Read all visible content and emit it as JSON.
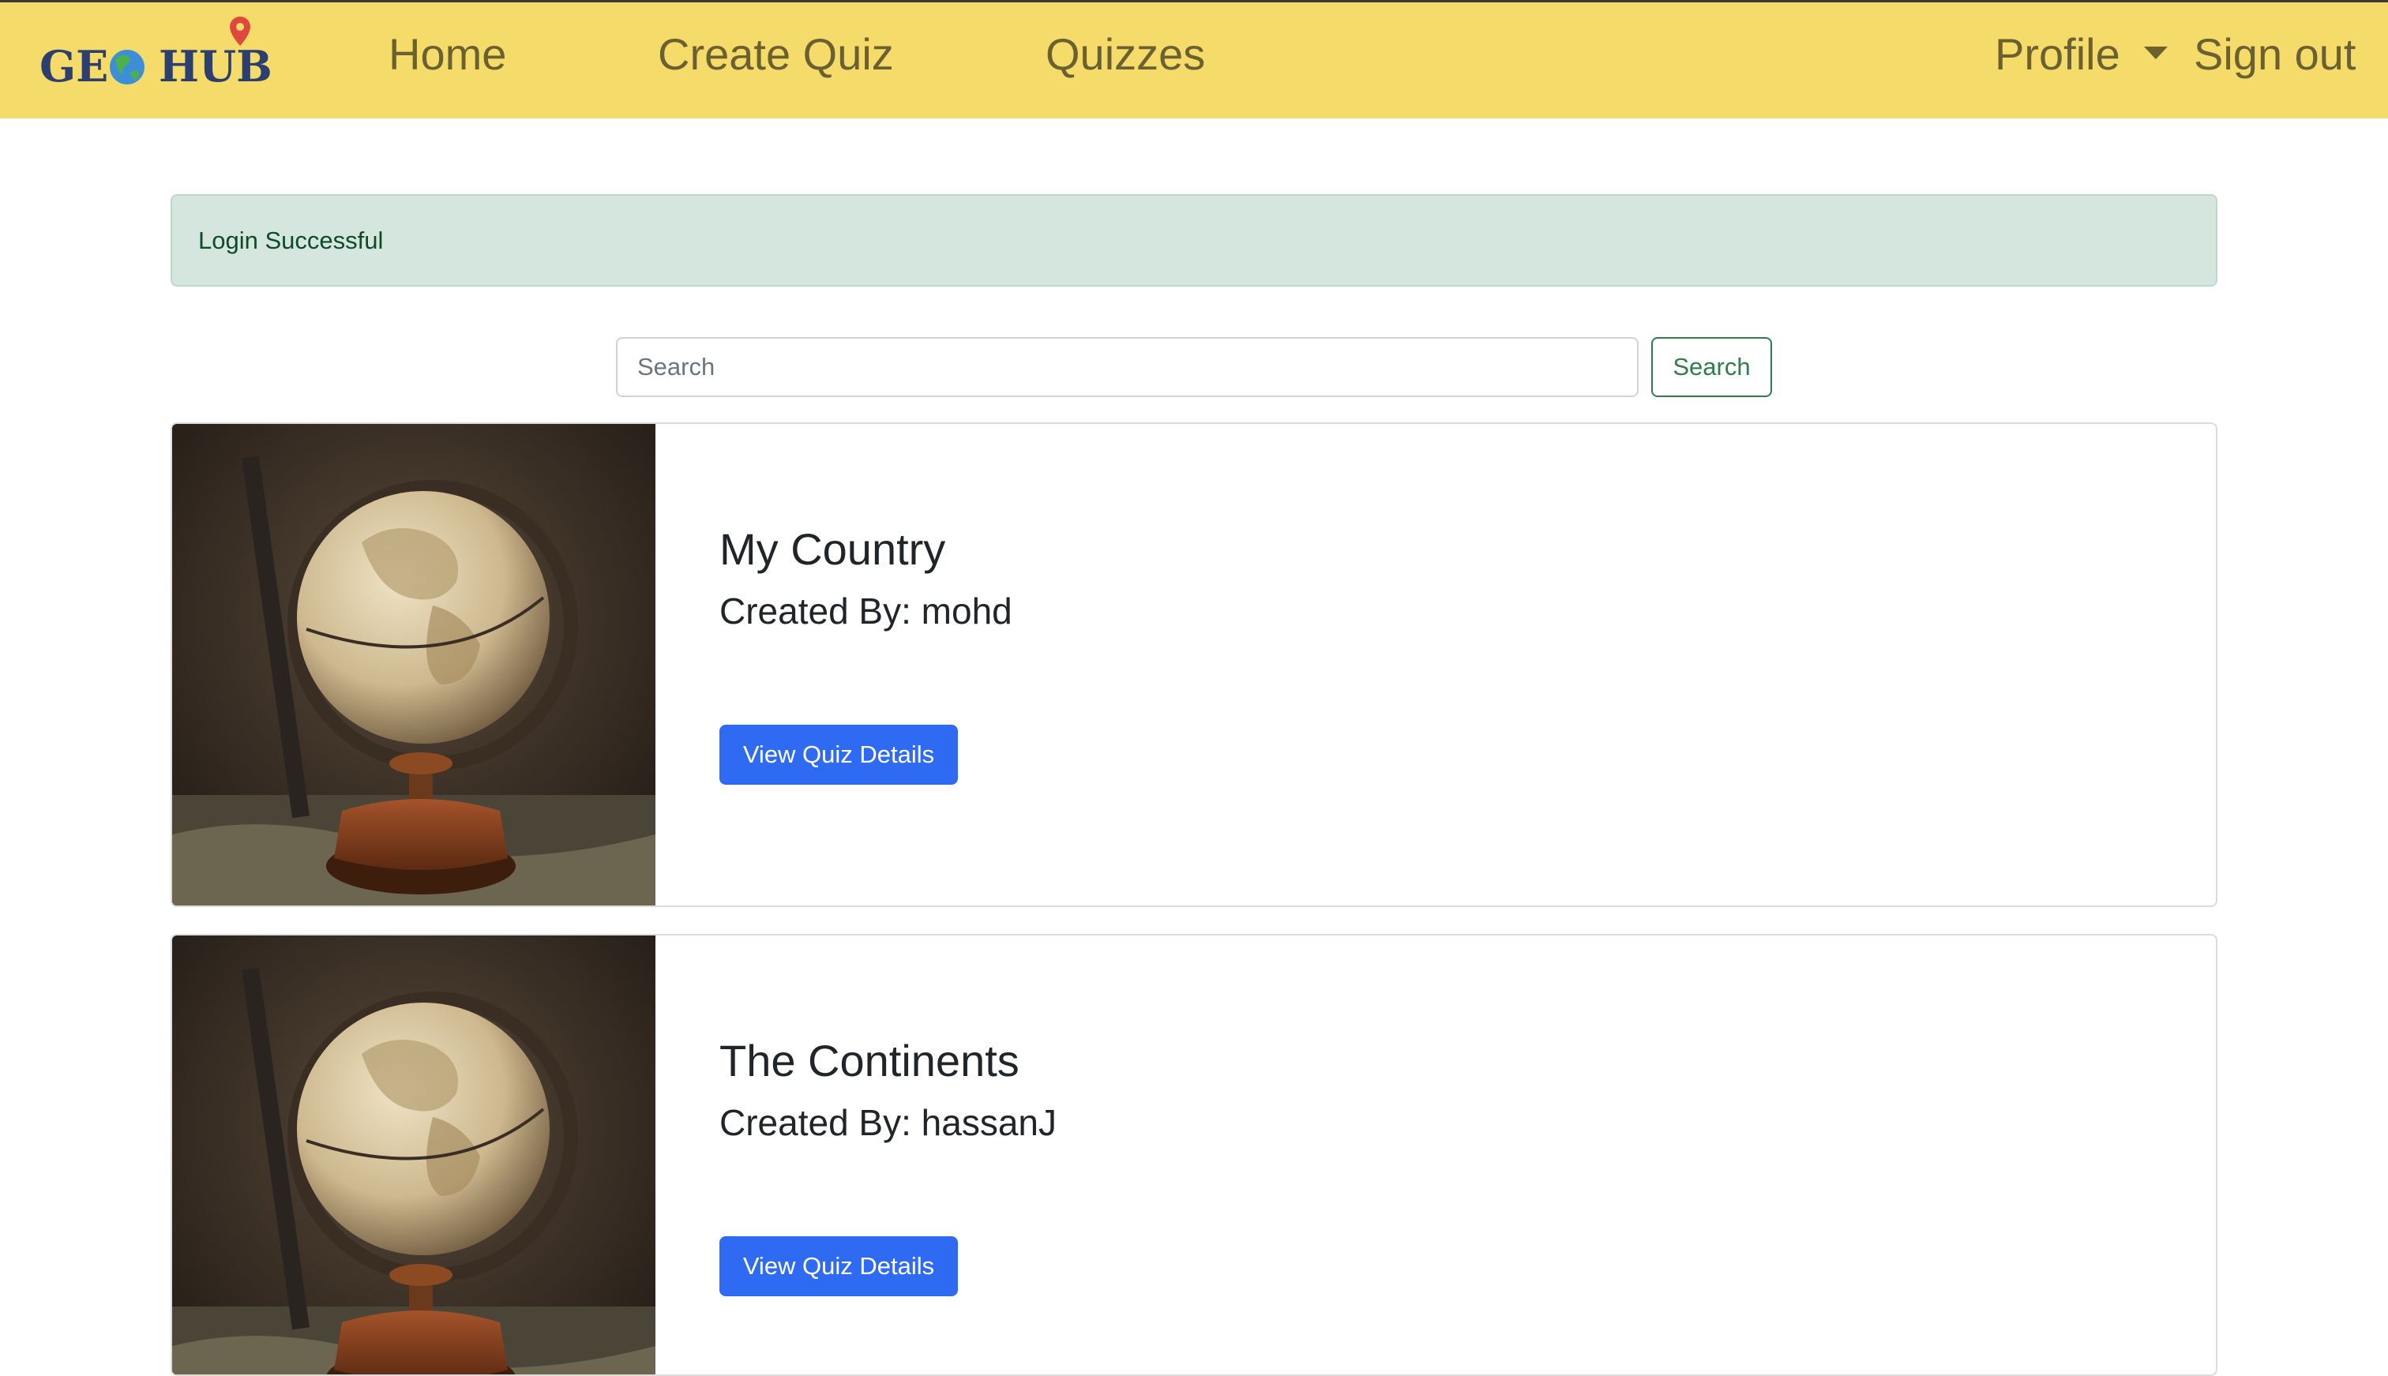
{
  "navbar": {
    "logo_text": "GEO HUB",
    "links": [
      {
        "label": "Home"
      },
      {
        "label": "Create Quiz"
      },
      {
        "label": "Quizzes"
      }
    ],
    "profile_label": "Profile",
    "signout_label": "Sign out",
    "background": "#f4db6a",
    "link_color": "#6b6130"
  },
  "alert": {
    "message": "Login Successful",
    "background": "#d4e6de"
  },
  "search": {
    "placeholder": "Search",
    "value": "",
    "button_label": "Search"
  },
  "quizzes": [
    {
      "title": "My Country",
      "author_text": "Created By: mohd",
      "button_label": "View Quiz Details",
      "image_icon": "globe-image"
    },
    {
      "title": "The Continents",
      "author_text": "Created By: hassanJ",
      "button_label": "View Quiz Details",
      "image_icon": "globe-image"
    }
  ],
  "colors": {
    "primary_button": "#2f6bf2",
    "search_button_outline": "#2e7d4a"
  }
}
